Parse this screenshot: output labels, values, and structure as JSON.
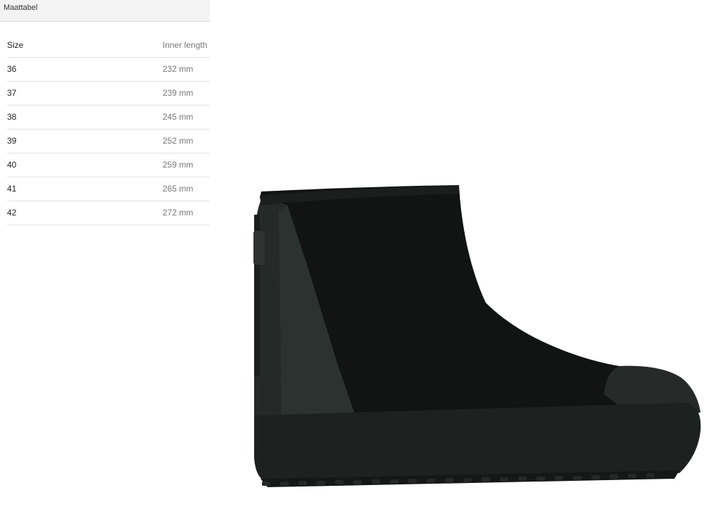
{
  "size_chart": {
    "title": "Maattabel",
    "columns": {
      "size": "Size",
      "inner_length": "Inner length"
    },
    "rows": [
      {
        "size": "36",
        "inner_length": "232 mm"
      },
      {
        "size": "37",
        "inner_length": "239 mm"
      },
      {
        "size": "38",
        "inner_length": "245 mm"
      },
      {
        "size": "39",
        "inner_length": "252 mm"
      },
      {
        "size": "40",
        "inner_length": "259 mm"
      },
      {
        "size": "41",
        "inner_length": "265 mm"
      },
      {
        "size": "42",
        "inner_length": "272 mm"
      }
    ]
  },
  "product": {
    "image_icon": "black-ankle-boot-image",
    "colors": {
      "upper": "#111413",
      "rubber": "#262b29",
      "sole": "#1d2220"
    }
  }
}
